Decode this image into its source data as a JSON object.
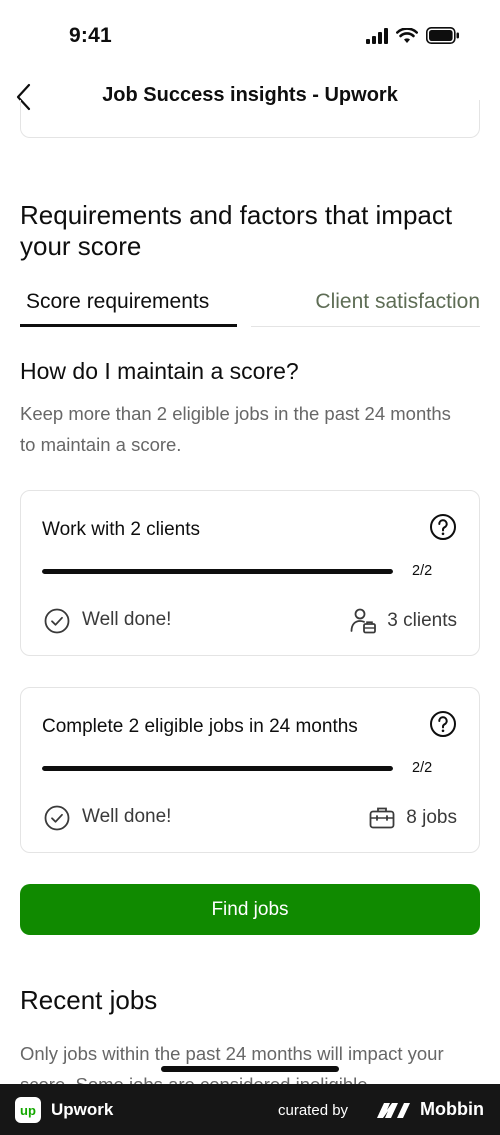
{
  "status_bar": {
    "time": "9:41"
  },
  "nav": {
    "title": "Job Success insights - Upwork"
  },
  "requirements": {
    "heading": "Requirements and factors that impact your score",
    "tabs": [
      {
        "label": "Score requirements",
        "active": true
      },
      {
        "label": "Client satisfaction",
        "active": false
      }
    ],
    "subheading": "How do I maintain a score?",
    "description": "Keep more than 2 eligible jobs in the past 24 months to maintain a score."
  },
  "cards": [
    {
      "title": "Work with 2 clients",
      "count": "2/2",
      "progress": 1.0,
      "status": "Well done!",
      "stat": "3 clients",
      "stat_icon": "client-icon"
    },
    {
      "title": "Complete 2 eligible jobs in 24 months",
      "count": "2/2",
      "progress": 1.0,
      "status": "Well done!",
      "stat": "8 jobs",
      "stat_icon": "briefcase-icon"
    }
  ],
  "find_jobs": {
    "label": "Find jobs"
  },
  "recent_jobs": {
    "heading": "Recent jobs",
    "description": "Only jobs within the past 24 months will impact your score. Some jobs are considered ineligible"
  },
  "footer": {
    "logo": "up",
    "app_name": "Upwork",
    "curated_by": "curated by",
    "brand": "Mobbin"
  },
  "colors": {
    "accent": "#108a00",
    "text": "#0e0e0e",
    "muted": "#676767",
    "border": "#e4e4e4"
  }
}
